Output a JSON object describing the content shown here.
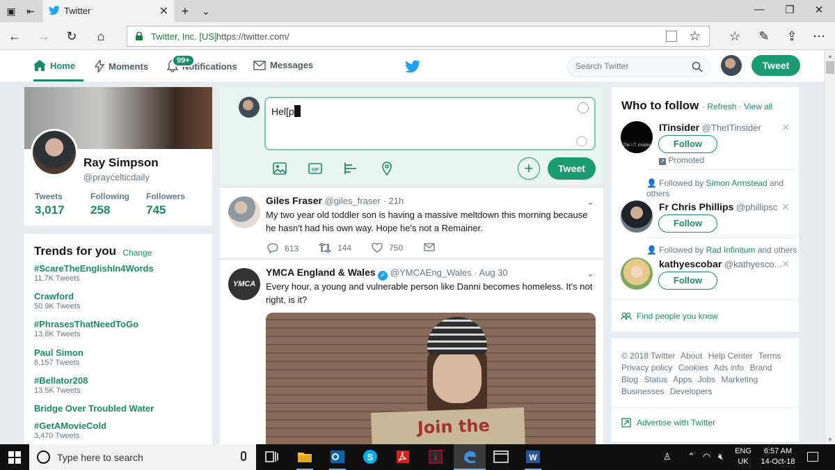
{
  "browser": {
    "tab_title": "Twitter",
    "org": "Twitter, Inc. [US]",
    "url": "https://twitter.com/"
  },
  "nav": {
    "home": "Home",
    "moments": "Moments",
    "notifications": "Notifications",
    "notifications_badge": "99+",
    "messages": "Messages",
    "search_placeholder": "Search Twitter",
    "tweet_button": "Tweet"
  },
  "profile": {
    "name": "Ray Simpson",
    "handle": "@praycelticdaily",
    "stats": [
      {
        "label": "Tweets",
        "value": "3,017"
      },
      {
        "label": "Following",
        "value": "258"
      },
      {
        "label": "Followers",
        "value": "745"
      }
    ]
  },
  "trends": {
    "title": "Trends for you",
    "change": "· Change",
    "items": [
      {
        "tag": "#ScareTheEnglishIn4Words",
        "count": "11.7K Tweets"
      },
      {
        "tag": "Crawford",
        "count": "50.9K Tweets"
      },
      {
        "tag": "#PhrasesThatNeedToGo",
        "count": "13.8K Tweets"
      },
      {
        "tag": "Paul Simon",
        "count": "6,157 Tweets"
      },
      {
        "tag": "#Bellator208",
        "count": "13.5K Tweets"
      },
      {
        "tag": "Bridge Over Troubled Water",
        "count": ""
      },
      {
        "tag": "#GetAMovieCold",
        "count": "3,470 Tweets"
      }
    ]
  },
  "compose": {
    "text": "Hel[p",
    "tweet_button": "Tweet"
  },
  "tweets": [
    {
      "name": "Giles Fraser",
      "handle": "@giles_fraser",
      "time": "· 21h",
      "body": "My two year old toddler son is having a massive meltdown this morning because he hasn't had his own way. Hope he's not a Remainer.",
      "replies": "613",
      "retweets": "144",
      "likes": "750"
    },
    {
      "name": "YMCA England & Wales",
      "handle": "@YMCAEng_Wales",
      "time": "· Aug 30",
      "body": "Every hour, a young and vulnerable person like Danni becomes homeless. It's not right, is it?",
      "avatar_text": "YMCA",
      "image_text": "Join the"
    }
  ],
  "who_to_follow": {
    "title": "Who to follow",
    "refresh": "Refresh",
    "view_all": "View all",
    "dot": "·",
    "follow_label": "Follow",
    "promoted": "Promoted",
    "find_people": "Find people you know",
    "suggestions": [
      {
        "name": "ITinsider",
        "handle": "@TheITinsider",
        "avatar_text": "The I.T. Insider",
        "context_prefix": "",
        "context_link": "",
        "context_suffix": ""
      },
      {
        "name": "Fr Chris Phillips",
        "handle": "@phillipsc",
        "context_prefix": "Followed by ",
        "context_link": "Simon Armstead",
        "context_suffix": " and others"
      },
      {
        "name": "kathyescobar",
        "handle": "@kathyesco...",
        "context_prefix": "Followed by ",
        "context_link": "Rad Infinitum",
        "context_suffix": " and others"
      }
    ]
  },
  "footer": {
    "links": [
      "© 2018 Twitter",
      "About",
      "Help Center",
      "Terms",
      "Privacy policy",
      "Cookies",
      "Ads info",
      "Brand",
      "Blog",
      "Status",
      "Apps",
      "Jobs",
      "Marketing",
      "Businesses",
      "Developers"
    ],
    "advertise": "Advertise with Twitter"
  },
  "taskbar": {
    "search_placeholder": "Type here to search",
    "lang_line1": "ENG",
    "lang_line2": "UK",
    "time": "6:57 AM",
    "date": "14-Oct-18"
  },
  "colors": {
    "accent": "#1a8a6a",
    "tweet_button": "#1a9b72",
    "verified": "#1da1f2"
  }
}
